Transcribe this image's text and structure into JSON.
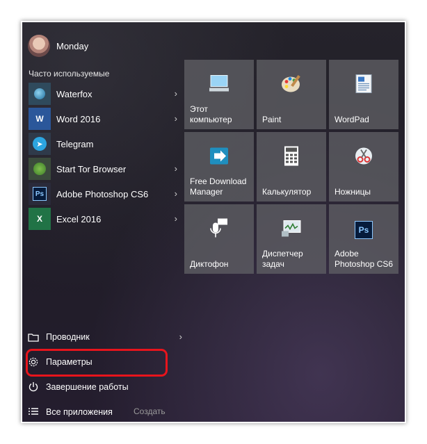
{
  "user": {
    "name": "Monday"
  },
  "section_title": "Часто используемые",
  "apps": [
    {
      "label": "Waterfox",
      "icon": "waterfox-icon",
      "has_arrow": true
    },
    {
      "label": "Word 2016",
      "icon": "word-icon",
      "icon_text": "W",
      "has_arrow": true
    },
    {
      "label": "Telegram",
      "icon": "telegram-icon",
      "has_arrow": false
    },
    {
      "label": "Start Tor Browser",
      "icon": "tor-icon",
      "has_arrow": true
    },
    {
      "label": "Adobe Photoshop CS6",
      "icon": "photoshop-icon",
      "icon_text": "Ps",
      "has_arrow": true
    },
    {
      "label": "Excel 2016",
      "icon": "excel-icon",
      "icon_text": "X",
      "has_arrow": true
    }
  ],
  "bottom": {
    "explorer": "Проводник",
    "settings": "Параметры",
    "shutdown": "Завершение работы",
    "all_apps": "Все приложения",
    "create": "Создать"
  },
  "tiles": [
    {
      "label": "Этот компьютер",
      "icon": "computer-icon"
    },
    {
      "label": "Paint",
      "icon": "paint-palette-icon"
    },
    {
      "label": "WordPad",
      "icon": "wordpad-icon"
    },
    {
      "label": "Free Download Manager",
      "icon": "download-manager-icon"
    },
    {
      "label": "Калькулятор",
      "icon": "calculator-icon"
    },
    {
      "label": "Ножницы",
      "icon": "scissors-icon"
    },
    {
      "label": "Диктофон",
      "icon": "microphone-icon"
    },
    {
      "label": "Диспетчер задач",
      "icon": "task-manager-icon"
    },
    {
      "label": "Adobe Photoshop CS6",
      "icon": "photoshop-icon",
      "icon_text": "Ps"
    }
  ],
  "colors": {
    "highlight": "#e8141c",
    "menu_bg": "#221f28",
    "tile_bg": "#5f5f64"
  }
}
